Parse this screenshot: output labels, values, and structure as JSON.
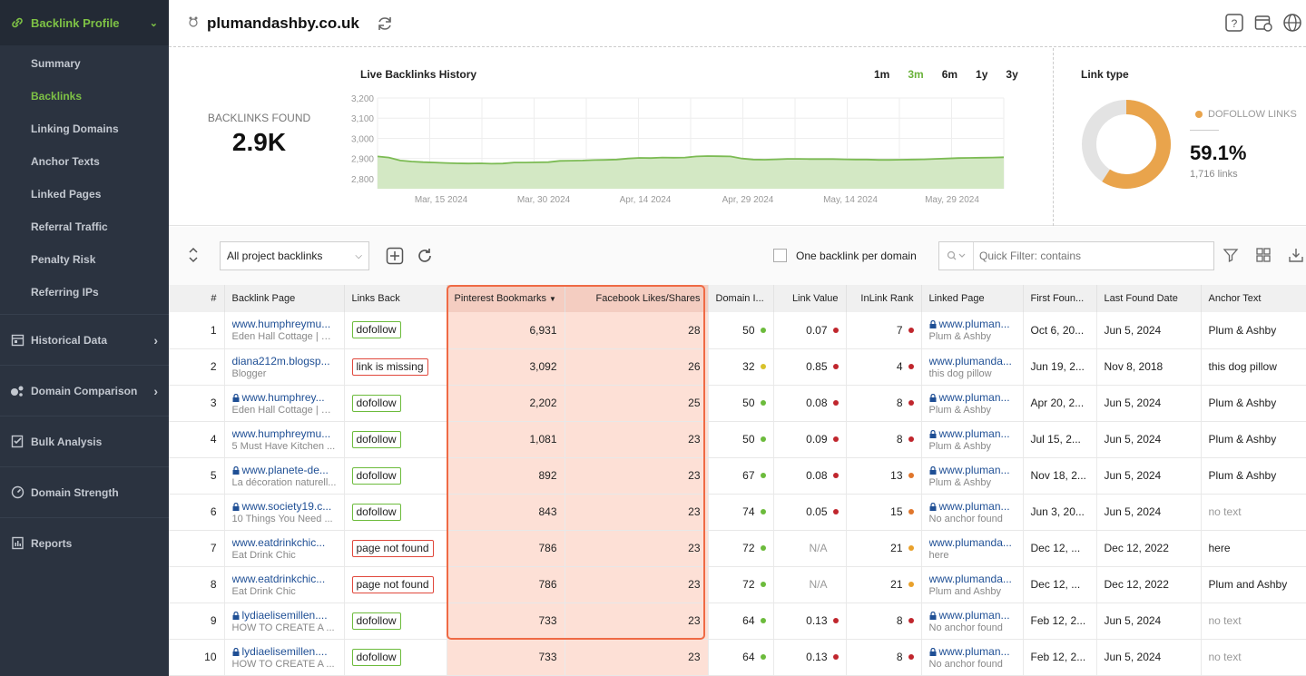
{
  "sidebar": {
    "header": "Backlink Profile",
    "items": [
      "Summary",
      "Backlinks",
      "Linking Domains",
      "Anchor Texts",
      "Linked Pages",
      "Referral Traffic",
      "Penalty Risk",
      "Referring IPs"
    ],
    "active_item": "Backlinks",
    "groups": [
      "Historical Data",
      "Domain Comparison",
      "Bulk Analysis",
      "Domain Strength",
      "Reports"
    ]
  },
  "header": {
    "domain": "plumandashby.co.uk"
  },
  "stats": {
    "backlinks_label": "BACKLINKS FOUND",
    "backlinks_value": "2.9K",
    "chart_title": "Live Backlinks History",
    "ranges": [
      "1m",
      "3m",
      "6m",
      "1y",
      "3y"
    ],
    "active_range": "3m",
    "link_type_title": "Link type",
    "link_type_legend": "DOFOLLOW LINKS",
    "link_type_pct": "59.1%",
    "link_type_count": "1,716 links"
  },
  "chart_data": {
    "type": "area",
    "y_ticks": [
      "3,200",
      "3,100",
      "3,000",
      "2,900",
      "2,800"
    ],
    "x_ticks": [
      "Mar, 15 2024",
      "Mar, 30 2024",
      "Apr, 14 2024",
      "Apr, 29 2024",
      "May, 14 2024",
      "May, 29 2024"
    ],
    "ylim": [
      2750,
      3200
    ],
    "values": [
      2910,
      2905,
      2890,
      2885,
      2882,
      2880,
      2878,
      2876,
      2875,
      2876,
      2874,
      2875,
      2880,
      2880,
      2881,
      2882,
      2888,
      2889,
      2890,
      2892,
      2893,
      2895,
      2900,
      2903,
      2902,
      2905,
      2904,
      2905,
      2910,
      2912,
      2911,
      2910,
      2900,
      2895,
      2894,
      2896,
      2898,
      2898,
      2897,
      2897,
      2897,
      2896,
      2895,
      2895,
      2893,
      2893,
      2894,
      2895,
      2896,
      2898,
      2900,
      2902,
      2903,
      2904,
      2905,
      2906
    ],
    "donut_value": 59.1
  },
  "toolbar": {
    "filter_select": "All project backlinks",
    "one_per_domain": "One backlink per domain",
    "quick_filter_placeholder": "Quick Filter: contains"
  },
  "table": {
    "columns": [
      "#",
      "Backlink Page",
      "Links Back",
      "Pinterest Bookmarks",
      "Facebook Likes/Shares",
      "Domain I...",
      "Link Value",
      "InLink Rank",
      "Linked Page",
      "First Foun...",
      "Last Found Date",
      "Anchor Text"
    ],
    "rows": [
      {
        "n": "1",
        "lock": false,
        "page": "www.humphreymu...",
        "page_sub": "Eden Hall Cottage | N...",
        "links_back": "dofollow",
        "lb_status": "ok",
        "pin": "6,931",
        "fb": "28",
        "di": "50",
        "di_c": "#6cbb3c",
        "lv": "0.07",
        "lv_c": "#c0262d",
        "ir": "7",
        "ir_c": "#c0262d",
        "lock2": true,
        "lp": "www.pluman...",
        "lp_sub": "Plum & Ashby",
        "first": "Oct 6, 20...",
        "last": "Jun 5, 2024",
        "anchor": "Plum & Ashby",
        "anchor_muted": false
      },
      {
        "n": "2",
        "lock": false,
        "page": "diana212m.blogsp...",
        "page_sub": "Blogger",
        "links_back": "link is missing",
        "lb_status": "bad",
        "pin": "3,092",
        "fb": "26",
        "di": "32",
        "di_c": "#d8c22c",
        "lv": "0.85",
        "lv_c": "#c0262d",
        "ir": "4",
        "ir_c": "#c0262d",
        "lock2": false,
        "lp": "www.plumanda...",
        "lp_sub": "this dog pillow",
        "first": "Jun 19, 2...",
        "last": "Nov 8, 2018",
        "anchor": "this dog pillow",
        "anchor_muted": false
      },
      {
        "n": "3",
        "lock": true,
        "page": "www.humphrey...",
        "page_sub": "Eden Hall Cottage | N...",
        "links_back": "dofollow",
        "lb_status": "ok",
        "pin": "2,202",
        "fb": "25",
        "di": "50",
        "di_c": "#6cbb3c",
        "lv": "0.08",
        "lv_c": "#c0262d",
        "ir": "8",
        "ir_c": "#c0262d",
        "lock2": true,
        "lp": "www.pluman...",
        "lp_sub": "Plum & Ashby",
        "first": "Apr 20, 2...",
        "last": "Jun 5, 2024",
        "anchor": "Plum & Ashby",
        "anchor_muted": false
      },
      {
        "n": "4",
        "lock": false,
        "page": "www.humphreymu...",
        "page_sub": "5 Must Have Kitchen ...",
        "links_back": "dofollow",
        "lb_status": "ok",
        "pin": "1,081",
        "fb": "23",
        "di": "50",
        "di_c": "#6cbb3c",
        "lv": "0.09",
        "lv_c": "#c0262d",
        "ir": "8",
        "ir_c": "#c0262d",
        "lock2": true,
        "lp": "www.pluman...",
        "lp_sub": "Plum & Ashby",
        "first": "Jul 15, 2...",
        "last": "Jun 5, 2024",
        "anchor": "Plum & Ashby",
        "anchor_muted": false
      },
      {
        "n": "5",
        "lock": true,
        "page": "www.planete-de...",
        "page_sub": "La décoration naturell...",
        "links_back": "dofollow",
        "lb_status": "ok",
        "pin": "892",
        "fb": "23",
        "di": "67",
        "di_c": "#6cbb3c",
        "lv": "0.08",
        "lv_c": "#c0262d",
        "ir": "13",
        "ir_c": "#e0762c",
        "lock2": true,
        "lp": "www.pluman...",
        "lp_sub": "Plum & Ashby",
        "first": "Nov 18, 2...",
        "last": "Jun 5, 2024",
        "anchor": "Plum & Ashby",
        "anchor_muted": false
      },
      {
        "n": "6",
        "lock": true,
        "page": "www.society19.c...",
        "page_sub": "10 Things You Need ...",
        "links_back": "dofollow",
        "lb_status": "ok",
        "pin": "843",
        "fb": "23",
        "di": "74",
        "di_c": "#6cbb3c",
        "lv": "0.05",
        "lv_c": "#c0262d",
        "ir": "15",
        "ir_c": "#e0762c",
        "lock2": true,
        "lp": "www.pluman...",
        "lp_sub": "No anchor found",
        "first": "Jun 3, 20...",
        "last": "Jun 5, 2024",
        "anchor": "no text",
        "anchor_muted": true
      },
      {
        "n": "7",
        "lock": false,
        "page": "www.eatdrinkchic...",
        "page_sub": "Eat Drink Chic",
        "links_back": "page not found",
        "lb_status": "bad",
        "pin": "786",
        "fb": "23",
        "di": "72",
        "di_c": "#6cbb3c",
        "lv": "N/A",
        "lv_c": "",
        "ir": "21",
        "ir_c": "#e9a12c",
        "lock2": false,
        "lp": "www.plumanda...",
        "lp_sub": "here",
        "first": "Dec 12, ...",
        "last": "Dec 12, 2022",
        "anchor": "here",
        "anchor_muted": false
      },
      {
        "n": "8",
        "lock": false,
        "page": "www.eatdrinkchic...",
        "page_sub": "Eat Drink Chic",
        "links_back": "page not found",
        "lb_status": "bad",
        "pin": "786",
        "fb": "23",
        "di": "72",
        "di_c": "#6cbb3c",
        "lv": "N/A",
        "lv_c": "",
        "ir": "21",
        "ir_c": "#e9a12c",
        "lock2": false,
        "lp": "www.plumanda...",
        "lp_sub": "Plum and Ashby",
        "first": "Dec 12, ...",
        "last": "Dec 12, 2022",
        "anchor": "Plum and Ashby",
        "anchor_muted": false
      },
      {
        "n": "9",
        "lock": true,
        "page": "lydiaelisemillen....",
        "page_sub": "HOW TO CREATE A ...",
        "links_back": "dofollow",
        "lb_status": "ok",
        "pin": "733",
        "fb": "23",
        "di": "64",
        "di_c": "#6cbb3c",
        "lv": "0.13",
        "lv_c": "#c0262d",
        "ir": "8",
        "ir_c": "#c0262d",
        "lock2": true,
        "lp": "www.pluman...",
        "lp_sub": "No anchor found",
        "first": "Feb 12, 2...",
        "last": "Jun 5, 2024",
        "anchor": "no text",
        "anchor_muted": true
      },
      {
        "n": "10",
        "lock": true,
        "page": "lydiaelisemillen....",
        "page_sub": "HOW TO CREATE A ...",
        "links_back": "dofollow",
        "lb_status": "ok",
        "pin": "733",
        "fb": "23",
        "di": "64",
        "di_c": "#6cbb3c",
        "lv": "0.13",
        "lv_c": "#c0262d",
        "ir": "8",
        "ir_c": "#c0262d",
        "lock2": true,
        "lp": "www.pluman...",
        "lp_sub": "No anchor found",
        "first": "Feb 12, 2...",
        "last": "Jun 5, 2024",
        "anchor": "no text",
        "anchor_muted": true
      }
    ]
  }
}
